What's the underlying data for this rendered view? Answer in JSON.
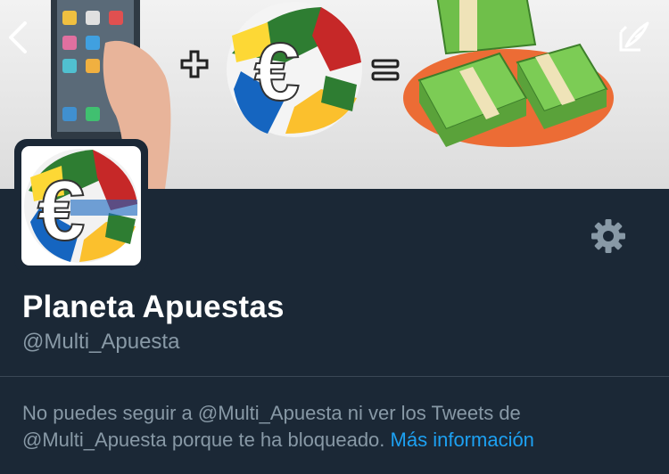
{
  "profile": {
    "display_name": "Planeta Apuestas",
    "handle": "@Multi_Apuesta"
  },
  "blocked_notice": {
    "text": "No puedes seguir a @Multi_Apuesta ni ver los Tweets de @Multi_Apuesta porque te ha bloqueado.",
    "link_label": "Más información"
  },
  "icons": {
    "back": "chevron-left-icon",
    "compose": "compose-icon",
    "settings": "gear-icon"
  },
  "colors": {
    "background": "#1b2836",
    "link": "#1da1f2",
    "secondary_text": "#8899a6"
  }
}
